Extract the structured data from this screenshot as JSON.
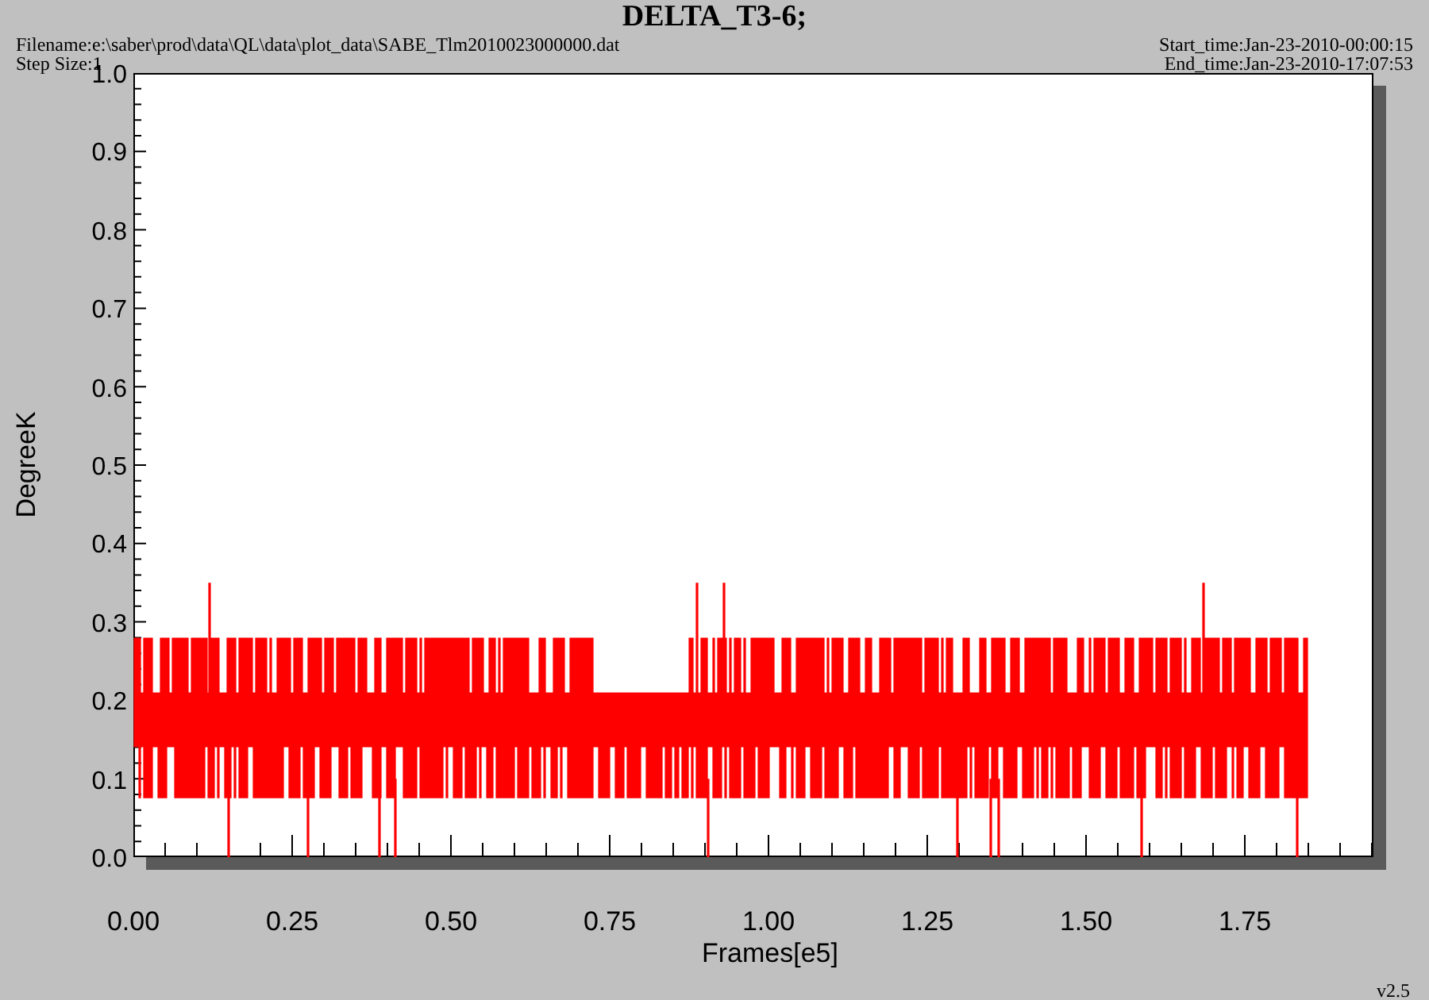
{
  "title": "DELTA_T3-6;",
  "filename": "Filename:e:\\saber\\prod\\data\\QL\\data\\plot_data\\SABE_Tlm2010023000000.dat",
  "step_size": "Step Size:1",
  "start_time": "Start_time:Jan-23-2010-00:00:15",
  "end_time": "End_time:Jan-23-2010-17:07:53",
  "plot": {
    "ylabel": "DegreeK",
    "xlabel": "Frames[e5]",
    "yticks": [
      "1.0",
      "0.9",
      "0.8",
      "0.7",
      "0.6",
      "0.5",
      "0.4",
      "0.3",
      "0.2",
      "0.1",
      "0.0"
    ],
    "xticks": [
      "0.00",
      "0.25",
      "0.50",
      "0.75",
      "1.00",
      "1.25",
      "1.50",
      "1.75"
    ]
  },
  "version": "v2.5"
}
